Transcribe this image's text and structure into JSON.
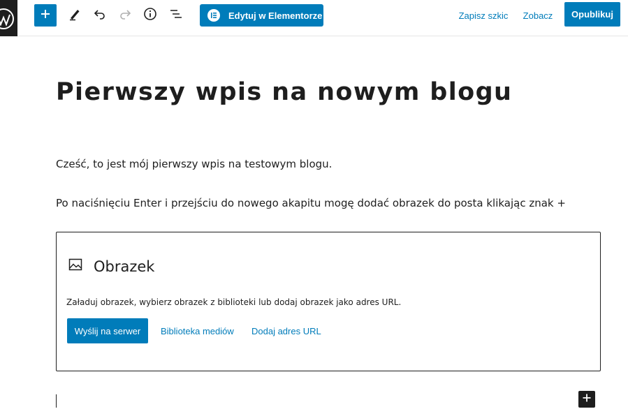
{
  "toolbar": {
    "icons": {
      "logo": "wordpress-logo-icon",
      "inserter": "plus-icon",
      "tools": "pencil-icon",
      "undo": "undo-icon",
      "redo": "redo-icon",
      "details": "info-icon",
      "outline": "list-view-icon",
      "elementor": "elementor-icon"
    },
    "elementor_label": "Edytuj w Elementorze",
    "save_draft_label": "Zapisz szkic",
    "preview_label": "Zobacz",
    "publish_label": "Opublikuj"
  },
  "post": {
    "title": "Pierwszy wpis na nowym blogu",
    "paragraphs": [
      "Cześć, to jest mój pierwszy wpis na testowym blogu.",
      "Po naciśnięciu Enter i przejściu do nowego akapitu mogę dodać obrazek do posta klikając znak +"
    ]
  },
  "image_block": {
    "icon": "image-icon",
    "title": "Obrazek",
    "instructions": "Załaduj obrazek, wybierz obrazek z biblioteki lub dodaj obrazek jako adres URL.",
    "upload_label": "Wyślij na serwer",
    "media_library_label": "Biblioteka mediów",
    "insert_url_label": "Dodaj adres URL"
  },
  "colors": {
    "accent": "#007cba",
    "text": "#1e1e1e",
    "background": "#ffffff"
  }
}
